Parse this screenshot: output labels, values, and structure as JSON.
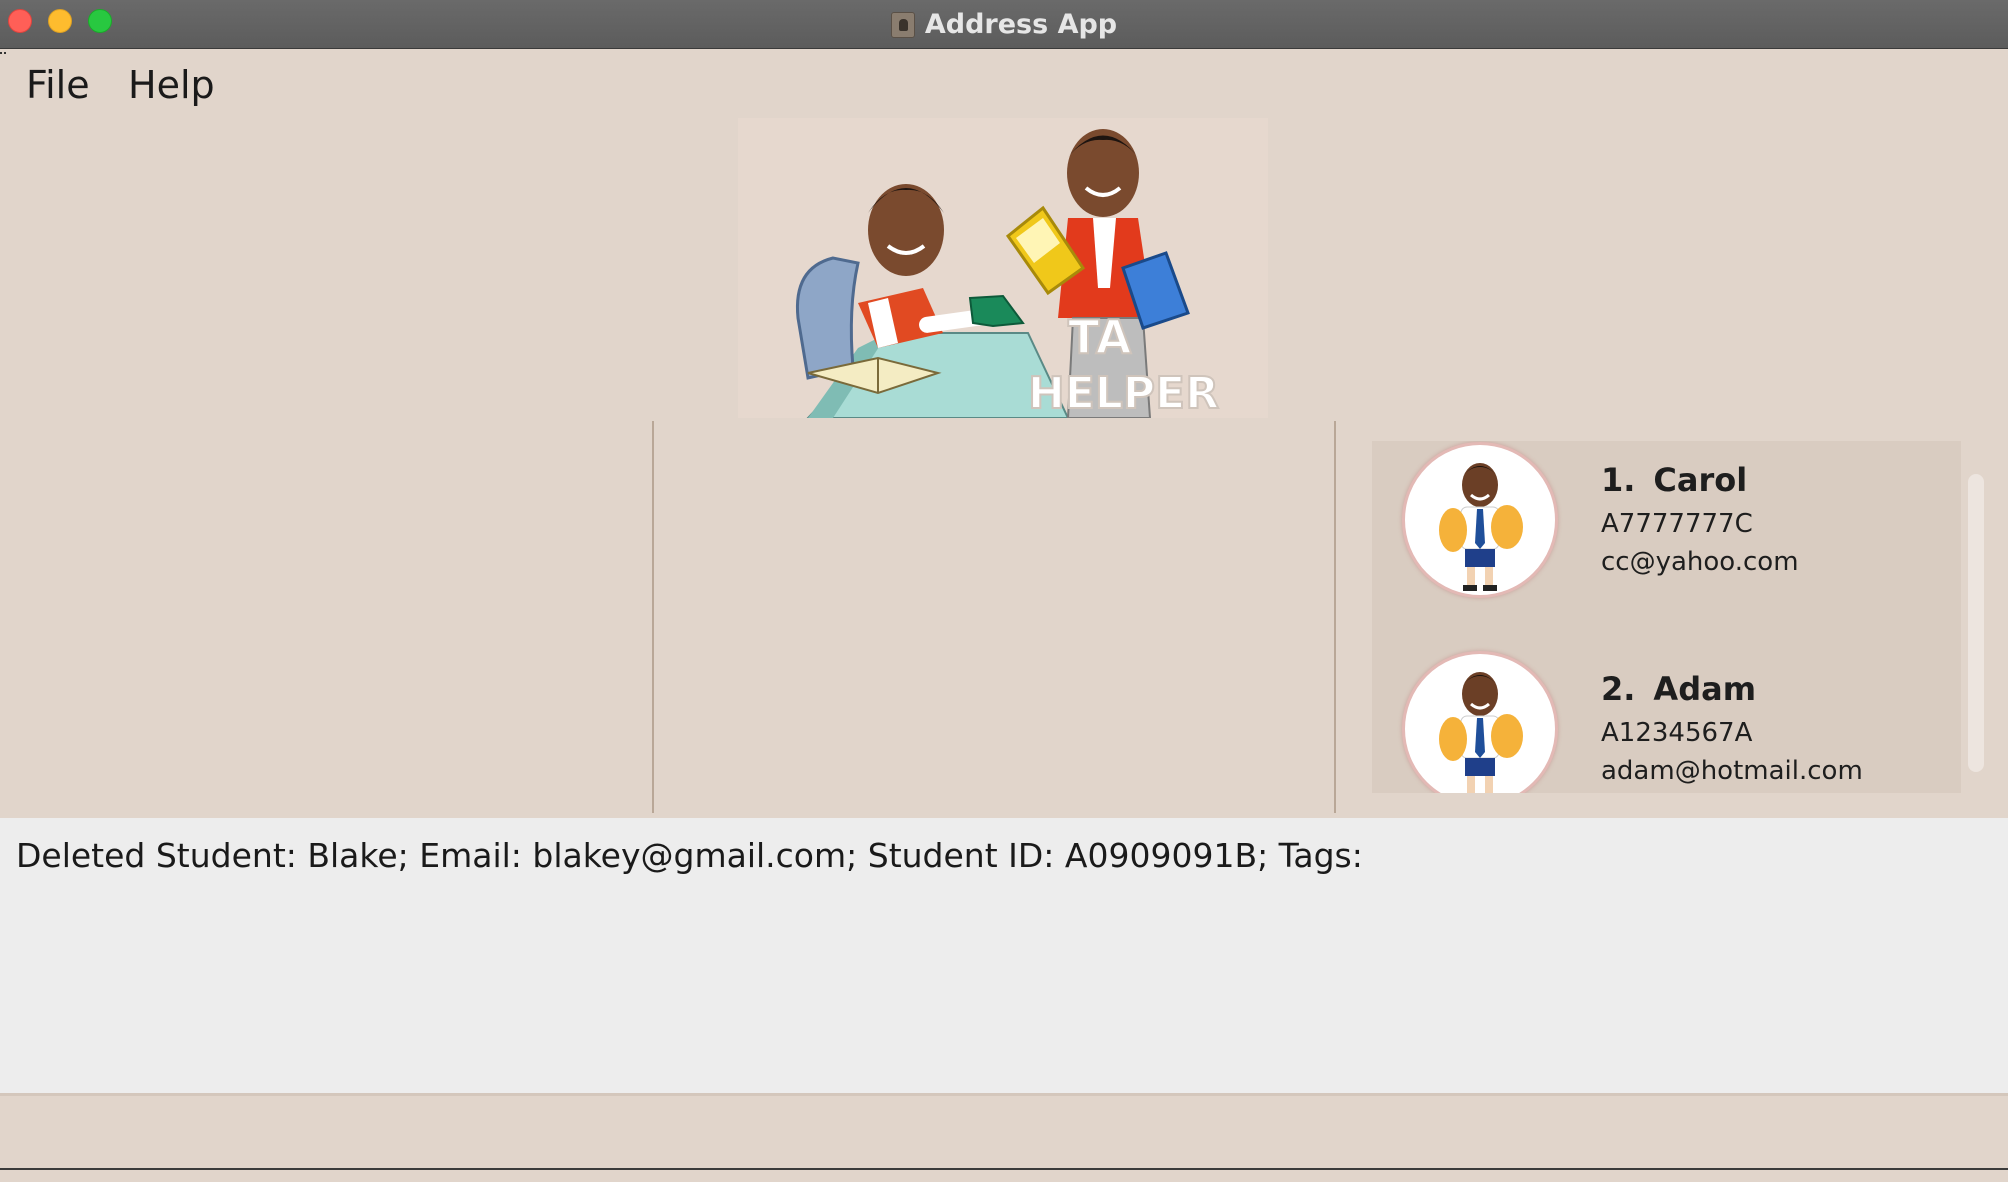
{
  "window": {
    "title": "Address App"
  },
  "menu": {
    "items": [
      "File",
      "Help"
    ]
  },
  "logo": {
    "text_line1": "TA",
    "text_line2": "HELPER"
  },
  "students": [
    {
      "index": "1.",
      "name": "Carol",
      "student_id": "A7777777C",
      "email": "cc@yahoo.com"
    },
    {
      "index": "2.",
      "name": "Adam",
      "student_id": "A1234567A",
      "email": "adam@hotmail.com"
    }
  ],
  "result_display": {
    "text": "Deleted Student: Blake; Email: blakey@gmail.com; Student ID: A0909091B; Tags:"
  },
  "colors": {
    "background": "#e1d5cb",
    "list_background": "#d9ccc1",
    "result_background": "#ededed",
    "title_bar": "#626262"
  }
}
